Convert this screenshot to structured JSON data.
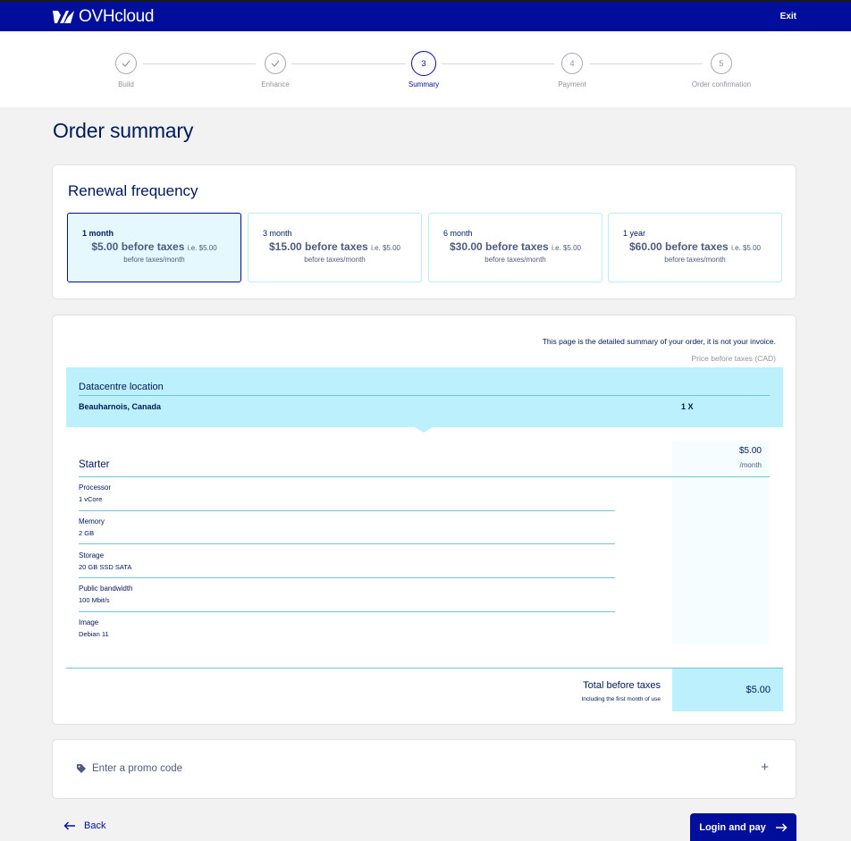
{
  "header": {
    "brand": "OVHcloud",
    "exit_label": "Exit"
  },
  "colors": {
    "brand_blue": "#000e9c",
    "highlight_cyan": "#bcf0fc"
  },
  "stepper": {
    "steps": [
      {
        "number": "1",
        "label": "Build",
        "state": "completed"
      },
      {
        "number": "2",
        "label": "Enhance",
        "state": "completed"
      },
      {
        "number": "3",
        "label": "Summary",
        "state": "active"
      },
      {
        "number": "4",
        "label": "Payment",
        "state": "pending"
      },
      {
        "number": "5",
        "label": "Order confirmation",
        "state": "pending"
      }
    ]
  },
  "page_title": "Order summary",
  "renewal": {
    "title": "Renewal frequency",
    "options": [
      {
        "period": "1 month",
        "price": "$5.00 before taxes",
        "ie": "i.e. $5.00",
        "per": "before taxes/month",
        "selected": true
      },
      {
        "period": "3 month",
        "price": "$15.00 before taxes",
        "ie": "i.e. $5.00",
        "per": "before taxes/month",
        "selected": false
      },
      {
        "period": "6 month",
        "price": "$30.00 before taxes",
        "ie": "i.e. $5.00",
        "per": "before taxes/month",
        "selected": false
      },
      {
        "period": "1 year",
        "price": "$60.00 before taxes",
        "ie": "i.e. $5.00",
        "per": "before taxes/month",
        "selected": false
      }
    ]
  },
  "summary": {
    "note": "This page is the detailed summary of your order, it is not your invoice.",
    "price_note": "Price before taxes (CAD)",
    "datacentre_label": "Datacentre location",
    "datacentre_value": "Beauharnois, Canada",
    "quantity": "1 X",
    "product_name": "Starter",
    "product_price": "$5.00",
    "product_period": "/month",
    "specs": [
      {
        "label": "Processor",
        "value": "1 vCore"
      },
      {
        "label": "Memory",
        "value": "2 GB"
      },
      {
        "label": "Storage",
        "value": "20 GB SSD SATA"
      },
      {
        "label": "Public bandwidth",
        "value": "100 Mbit/s"
      },
      {
        "label": "Image",
        "value": "Debian 11"
      }
    ],
    "total_label": "Total before taxes",
    "total_sub": "Including the first month of use",
    "total_value": "$5.00"
  },
  "promo": {
    "label": "Enter a promo code",
    "expand_symbol": "+"
  },
  "footer": {
    "back_label": "Back",
    "pay_label": "Login and pay"
  }
}
